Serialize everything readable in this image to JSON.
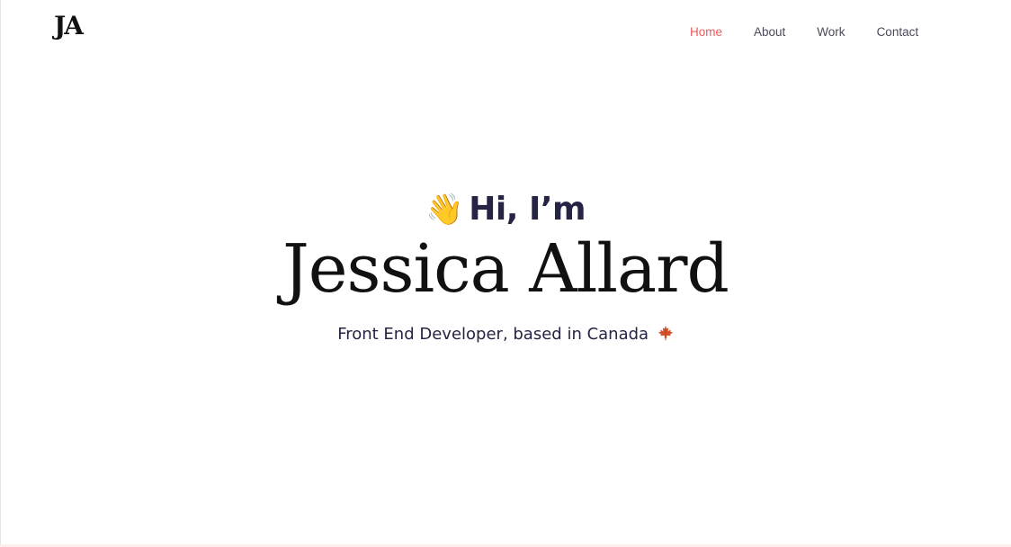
{
  "logo": {
    "text": "JA"
  },
  "nav": {
    "items": [
      {
        "label": "Home",
        "active": true
      },
      {
        "label": "About",
        "active": false
      },
      {
        "label": "Work",
        "active": false
      },
      {
        "label": "Contact",
        "active": false
      }
    ],
    "active_color": "#ec5b5b"
  },
  "hero": {
    "greeting": "Hi, I’m",
    "greeting_emoji": "waving-hand-icon",
    "name": "Jessica Allard",
    "tagline": "Front End Developer, based in Canada",
    "tagline_icon": "maple-leaf-icon"
  },
  "colors": {
    "heading": "#262445",
    "name": "#111111",
    "nav_default": "#4a4a5a"
  }
}
